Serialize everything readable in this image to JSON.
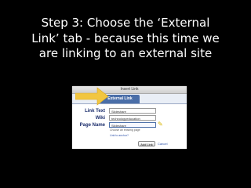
{
  "slide": {
    "caption": "Step 3: Choose the ‘External\nLink’ tab - because this time we\nare linking to an external site"
  },
  "dialog": {
    "title": "Insert Link",
    "tab_label": "External Link",
    "fields": {
      "link_text": {
        "label": "Link Text",
        "value": "Slideshare"
      },
      "wiki": {
        "label": "Wiki",
        "value": "technologyeducation"
      },
      "page_name": {
        "label": "Page Name",
        "value": "Slideshare"
      }
    },
    "hint": "Choose an existing page",
    "secondary_link": "Link to anchor?",
    "add_button": "Add Link",
    "cancel": "Cancel"
  },
  "icons": {
    "arrow": "arrow-right-icon",
    "cursor": "pointer-cursor-icon"
  },
  "colors": {
    "slide_background": "#000000",
    "caption_text": "#ffffff",
    "arrow": "#f2c640",
    "tab_active": "#4a6ea8",
    "label_text": "#1a2c6b"
  }
}
